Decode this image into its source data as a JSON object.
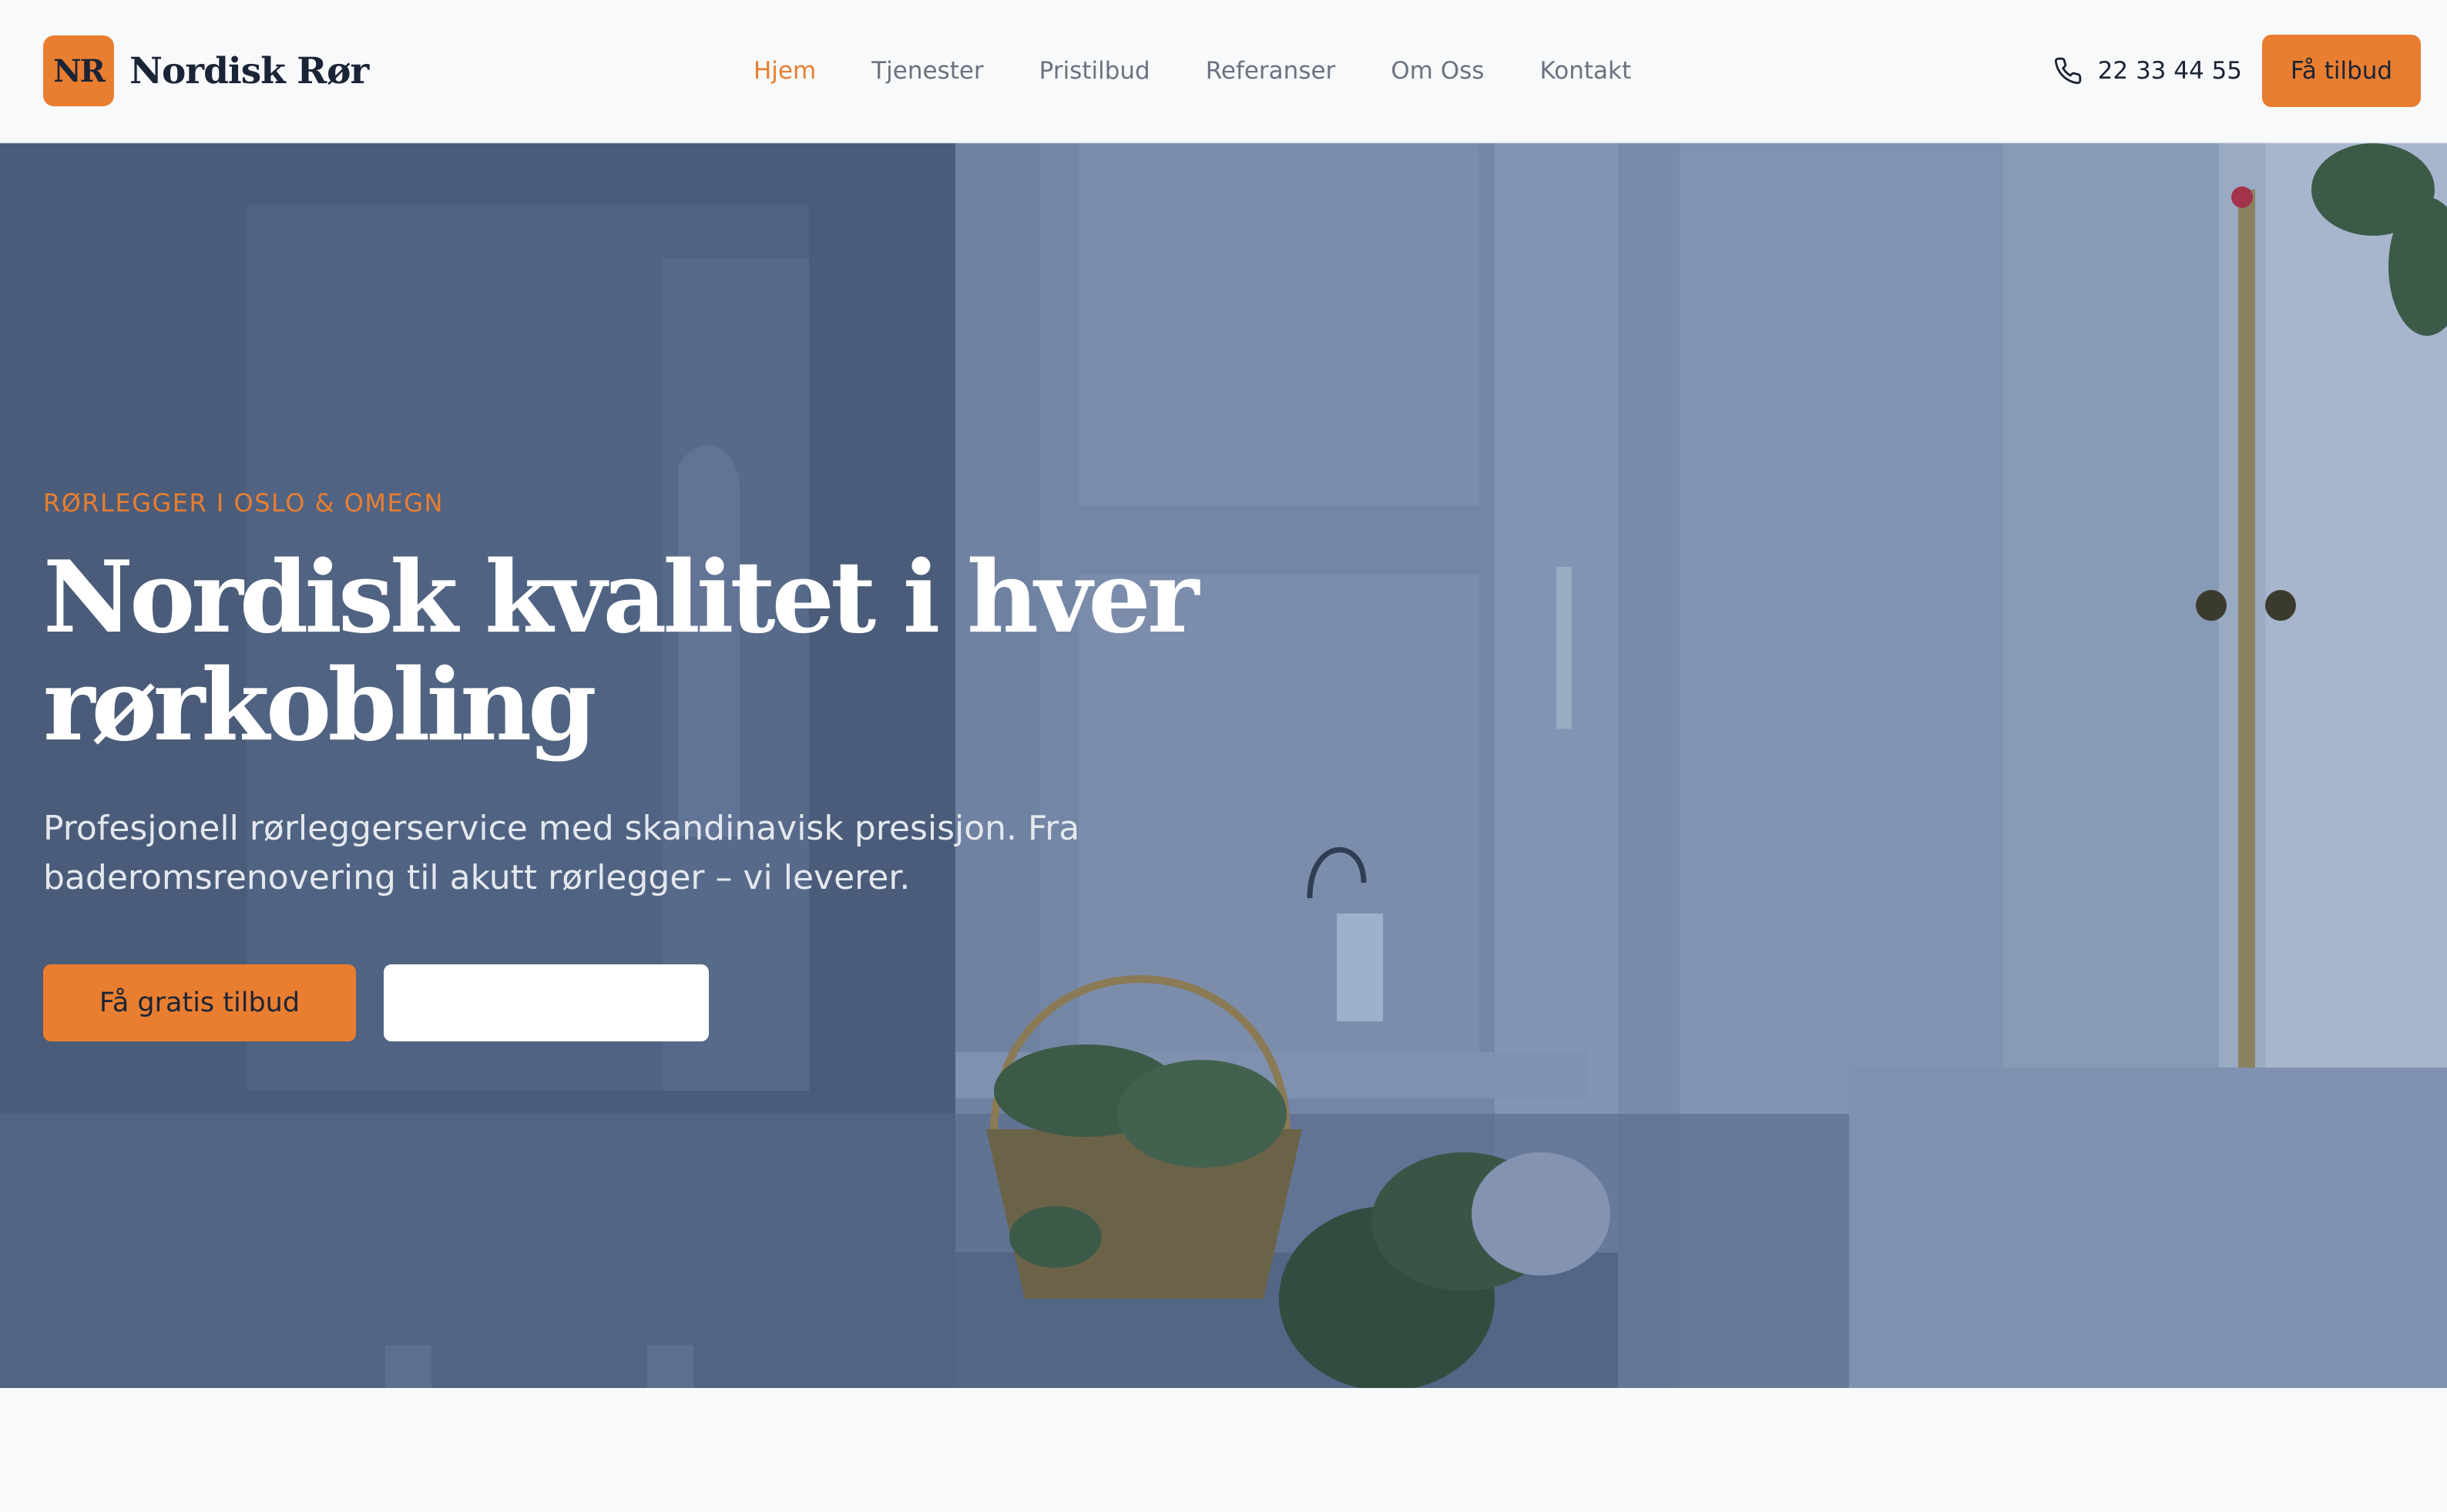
{
  "brand": {
    "logo_mark": "NR",
    "name": "Nordisk Rør",
    "accent_color": "#e97e30",
    "text_color": "#1b2436"
  },
  "nav": {
    "items": [
      {
        "label": "Hjem",
        "active": true
      },
      {
        "label": "Tjenester",
        "active": false
      },
      {
        "label": "Pristilbud",
        "active": false
      },
      {
        "label": "Referanser",
        "active": false
      },
      {
        "label": "Om Oss",
        "active": false
      },
      {
        "label": "Kontakt",
        "active": false
      }
    ]
  },
  "header": {
    "phone_icon": "phone-icon",
    "phone": "22 33 44 55",
    "cta_label": "Få tilbud"
  },
  "hero": {
    "eyebrow": "RØRLEGGER I OSLO & OMEGN",
    "title": "Nordisk kvalitet i hver rørkobling",
    "subtitle": "Profesjonell rørleggerservice med skandinavisk presisjon. Fra baderomsrenovering til akutt rørlegger – vi leverer.",
    "primary_button": "Få gratis tilbud",
    "secondary_button": "",
    "overlay_color": "#4e617e"
  }
}
